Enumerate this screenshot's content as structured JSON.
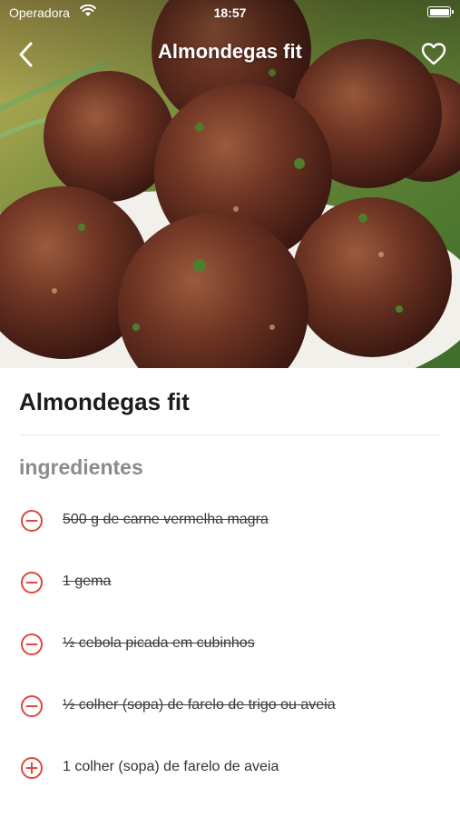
{
  "status_bar": {
    "carrier": "Operadora",
    "time": "18:57"
  },
  "nav": {
    "title": "Almondegas fit",
    "back_icon": "chevron-left-icon",
    "favorite_icon": "heart-outline-icon"
  },
  "recipe": {
    "title": "Almondegas fit",
    "section_title": "ingredientes"
  },
  "colors": {
    "accent": "#e0453f",
    "text": "#333333",
    "section": "#8b8b8b"
  },
  "ingredients": [
    {
      "text": "500 g de carne vermelha magra",
      "checked": true,
      "icon": "minus-circle-icon"
    },
    {
      "text": "1 gema",
      "checked": true,
      "icon": "minus-circle-icon"
    },
    {
      "text": "½ cebola picada em cubinhos",
      "checked": true,
      "icon": "minus-circle-icon"
    },
    {
      "text": "½ colher (sopa) de farelo de trigo ou aveia",
      "checked": true,
      "icon": "minus-circle-icon"
    },
    {
      "text": "1 colher (sopa) de farelo de aveia",
      "checked": false,
      "icon": "plus-circle-icon"
    }
  ]
}
